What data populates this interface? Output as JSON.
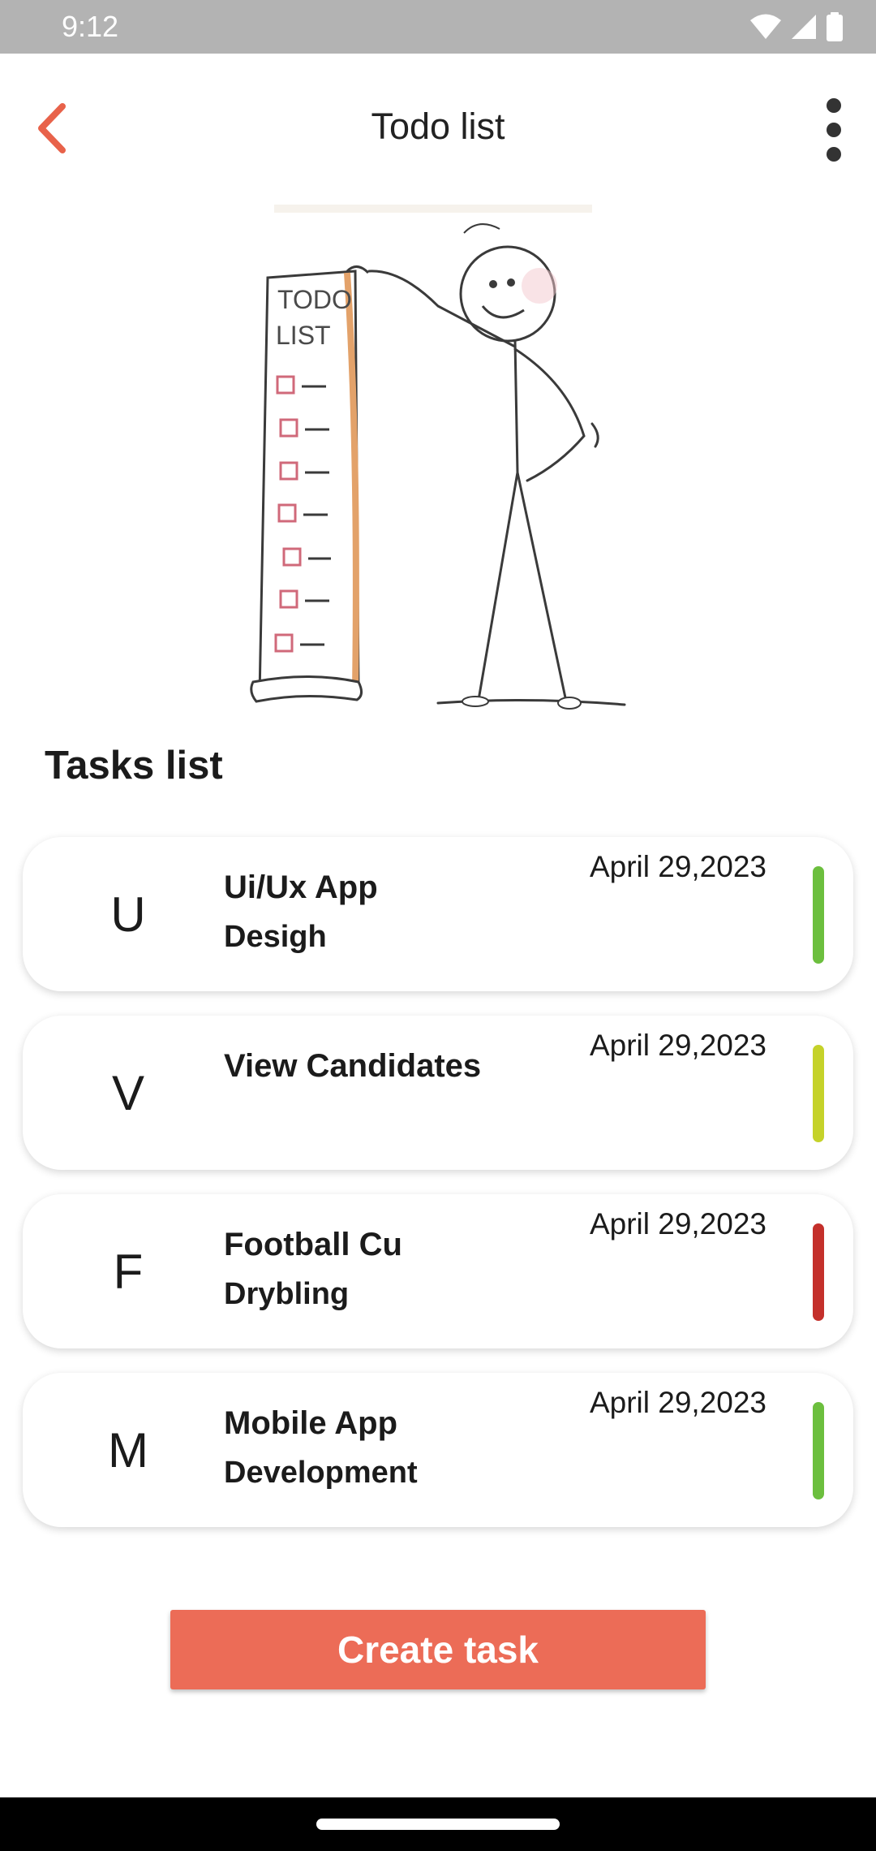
{
  "status_bar": {
    "time": "9:12",
    "icons": [
      "wifi-icon",
      "signal-icon",
      "battery-icon"
    ]
  },
  "app_bar": {
    "title": "Todo list",
    "back_icon": "chevron-left-icon",
    "menu_icon": "more-vert-icon",
    "accent_color": "#e8624a"
  },
  "illustration": {
    "description_icon": "todo-list-stickman-illustration",
    "scroll_text_line1": "TODO",
    "scroll_text_line2": "LIST"
  },
  "section": {
    "title": "Tasks list"
  },
  "tasks": [
    {
      "initial": "U",
      "title": "Ui/Ux App",
      "subtitle": "Desigh",
      "date": "April 29,2023",
      "priority_color": "#6cbf3e"
    },
    {
      "initial": "V",
      "title": "View Candidates",
      "subtitle": "",
      "date": "April 29,2023",
      "priority_color": "#c5d22a"
    },
    {
      "initial": "F",
      "title": "Football Cu",
      "subtitle": "Drybling",
      "date": "April 29,2023",
      "priority_color": "#c4302b"
    },
    {
      "initial": "M",
      "title": "Mobile App",
      "subtitle": "Development",
      "date": "April 29,2023",
      "priority_color": "#6cbf3e"
    }
  ],
  "actions": {
    "create_label": "Create task",
    "create_color": "#ec6c57"
  }
}
